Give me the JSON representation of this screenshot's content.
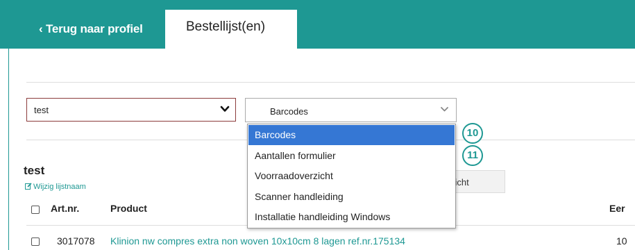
{
  "tabs": {
    "back_label": "‹ Terug naar profiel",
    "active_label": "Bestellijst(en)"
  },
  "list_select": {
    "value": "test"
  },
  "download_select": {
    "value": "Barcodes"
  },
  "dropdown": {
    "options": [
      "Barcodes",
      "Aantallen formulier",
      "Voorraadoverzicht",
      "Scanner handleiding",
      "Installatie handleiding Windows"
    ],
    "selected_index": 0
  },
  "badges": [
    "10",
    "11"
  ],
  "list": {
    "title": "test",
    "edit_label": "Wijzig lijstnaam",
    "overzicht_label": "zicht"
  },
  "table": {
    "headers": {
      "artnr": "Art.nr.",
      "product": "Product",
      "unit": "Eer"
    },
    "rows": [
      {
        "artnr": "3017078",
        "product": "Klinion nw compres extra non woven 10x10cm 8 lagen ref.nr.175134",
        "unit": "10"
      }
    ]
  },
  "colors": {
    "brand": "#1e9893",
    "selected": "#3577d4",
    "select_border": "#8b3b3b"
  },
  "icons": [
    "chevron-down-icon",
    "edit-icon",
    "checkbox-icon"
  ]
}
